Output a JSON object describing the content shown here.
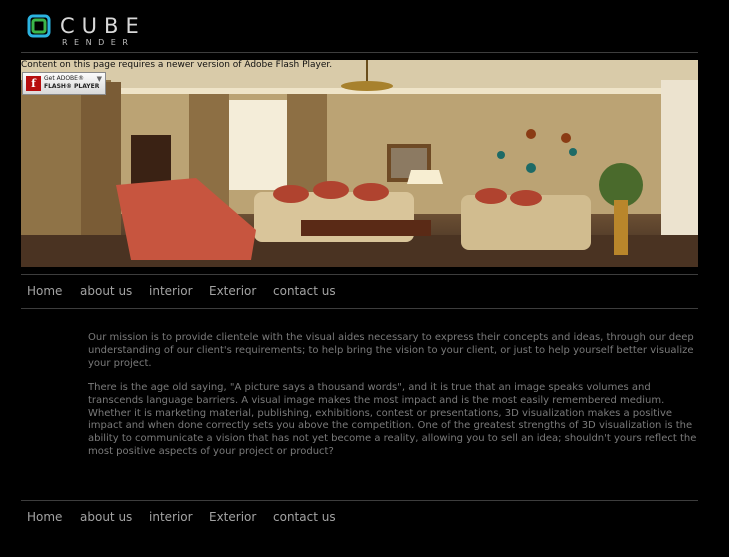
{
  "brand": {
    "name": "CUBE",
    "tagline": "RENDER",
    "mark_colors": [
      "#2cb3e0",
      "#3bb54a"
    ]
  },
  "flash": {
    "message": "Content on this page requires a newer version of Adobe Flash Player.",
    "badge_line1": "Get ADOBE®",
    "badge_line2": "FLASH® PLAYER",
    "icon_symbol": "f"
  },
  "banner": {
    "image": "living-room-interior-render"
  },
  "nav_top": {
    "items": [
      "Home",
      "about us",
      "interior",
      "Exterior",
      "contact us"
    ]
  },
  "main": {
    "paragraphs": [
      "Our mission is to provide clientele with the visual aides necessary to express their concepts and ideas, through our deep understanding of our client's requirements; to help bring the vision to your client, or just to help yourself better visualize your project.",
      "There is the age old saying, \"A picture says a thousand words\", and it is true that an image speaks volumes and transcends language barriers. A visual image makes the most impact and is the most easily remembered medium. Whether it is marketing material, publishing, exhibitions, contest or presentations, 3D visualization makes a positive impact and when done correctly sets you above the competition. One of the greatest strengths of 3D visualization is the ability to communicate a vision that has not yet become a reality, allowing you to sell an idea; shouldn't yours reflect the most positive aspects of your project or product?"
    ]
  },
  "nav_bottom": {
    "items": [
      "Home",
      "about us",
      "interior",
      "Exterior",
      "contact us"
    ]
  }
}
